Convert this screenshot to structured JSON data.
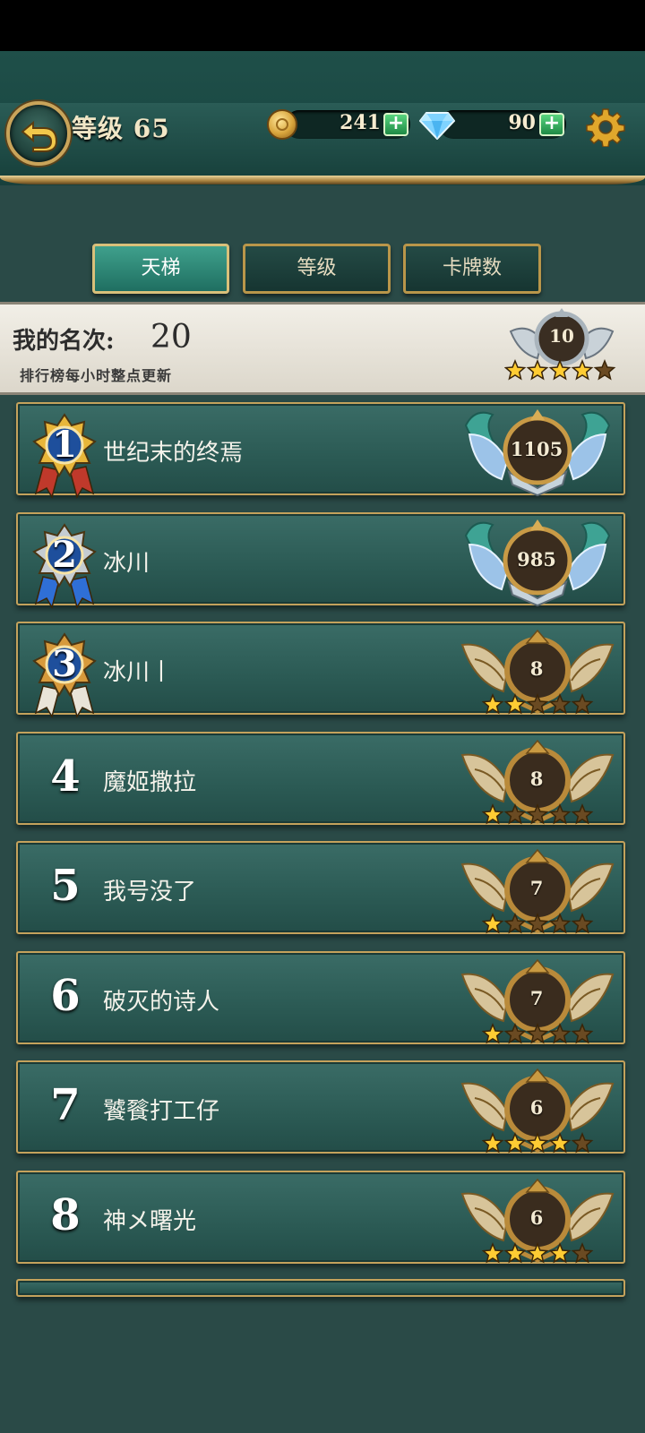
{
  "header": {
    "level_label": "等级 65",
    "gold": "241",
    "gems": "90",
    "plus": "+"
  },
  "tabs": [
    {
      "label": "天梯",
      "active": true
    },
    {
      "label": "等级",
      "active": false
    },
    {
      "label": "卡牌数",
      "active": false
    }
  ],
  "my_rank": {
    "label": "我的名次:",
    "value": "20",
    "note": "排行榜每小时整点更新",
    "badge_value": "10",
    "stars_filled": 4,
    "stars_total": 5
  },
  "leaderboard": [
    {
      "rank": "1",
      "name": "世纪末的终焉",
      "score": "1105",
      "tier": "legend",
      "stars_filled": 0
    },
    {
      "rank": "2",
      "name": "冰川",
      "score": "985",
      "tier": "legend",
      "stars_filled": 0
    },
    {
      "rank": "3",
      "name": "冰川丨",
      "score": "8",
      "tier": "gold",
      "stars_filled": 2
    },
    {
      "rank": "4",
      "name": "魔姬撒拉",
      "score": "8",
      "tier": "gold",
      "stars_filled": 1
    },
    {
      "rank": "5",
      "name": "我号没了",
      "score": "7",
      "tier": "gold",
      "stars_filled": 1
    },
    {
      "rank": "6",
      "name": "破灭的诗人",
      "score": "7",
      "tier": "gold",
      "stars_filled": 1
    },
    {
      "rank": "7",
      "name": "饕餮打工仔",
      "score": "6",
      "tier": "gold",
      "stars_filled": 4
    },
    {
      "rank": "8",
      "name": "神メ曙光",
      "score": "6",
      "tier": "gold",
      "stars_filled": 4
    }
  ],
  "colors": {
    "bg": "#2a4a47",
    "gold_trim": "#c4a25c",
    "tab_active": "#2f8f7c",
    "star_filled": "#ffcc33",
    "star_empty": "#6a4a22"
  }
}
